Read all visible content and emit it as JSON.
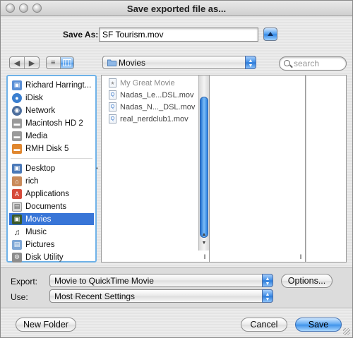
{
  "window": {
    "title": "Save exported file as..."
  },
  "save_as": {
    "label": "Save As:",
    "value": "SF Tourism.mov"
  },
  "toolbar": {
    "back_icon": "chevron-left-icon",
    "forward_icon": "chevron-right-icon",
    "list_view_icon": "list-view-icon",
    "column_view_icon": "column-view-icon",
    "location": "Movies",
    "search_placeholder": "search"
  },
  "sidebar": {
    "devices": [
      {
        "label": "Richard Harringt...",
        "icon": "computer-icon"
      },
      {
        "label": "iDisk",
        "icon": "idisk-icon"
      },
      {
        "label": "Network",
        "icon": "network-icon"
      },
      {
        "label": "Macintosh HD 2",
        "icon": "hard-drive-icon"
      },
      {
        "label": "Media",
        "icon": "hard-drive-icon"
      },
      {
        "label": "RMH Disk 5",
        "icon": "external-drive-icon"
      }
    ],
    "places": [
      {
        "label": "Desktop",
        "icon": "desktop-icon"
      },
      {
        "label": "rich",
        "icon": "home-icon"
      },
      {
        "label": "Applications",
        "icon": "applications-icon"
      },
      {
        "label": "Documents",
        "icon": "documents-icon"
      },
      {
        "label": "Movies",
        "icon": "movies-icon",
        "selected": true
      },
      {
        "label": "Music",
        "icon": "music-icon"
      },
      {
        "label": "Pictures",
        "icon": "pictures-icon"
      },
      {
        "label": "Disk Utility",
        "icon": "disk-utility-icon"
      }
    ]
  },
  "files": [
    {
      "name": "My Great Movie",
      "icon": "project-icon"
    },
    {
      "name": "Nadas_Le...DSL.mov",
      "icon": "quicktime-icon"
    },
    {
      "name": "Nadas_N..._DSL.mov",
      "icon": "quicktime-icon"
    },
    {
      "name": "real_nerdclub1.mov",
      "icon": "quicktime-icon"
    }
  ],
  "export": {
    "label": "Export:",
    "value": "Movie to QuickTime Movie",
    "options_label": "Options..."
  },
  "use": {
    "label": "Use:",
    "value": "Most Recent Settings"
  },
  "buttons": {
    "new_folder": "New Folder",
    "cancel": "Cancel",
    "save": "Save"
  },
  "colors": {
    "accent": "#3875d7",
    "sidebar_border": "#6fb2e8"
  }
}
